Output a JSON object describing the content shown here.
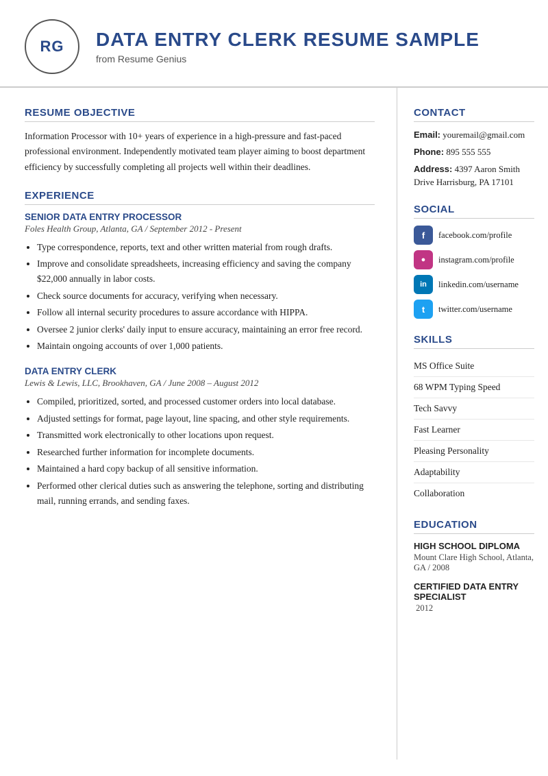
{
  "header": {
    "initials": "RG",
    "title": "DATA ENTRY CLERK RESUME SAMPLE",
    "subtitle": "from Resume Genius"
  },
  "left": {
    "objective_title": "RESUME OBJECTIVE",
    "objective_text": "Information Processor with 10+ years of experience in a high-pressure and fast-paced professional environment. Independently motivated team player aiming to boost department efficiency by successfully completing all projects well within their deadlines.",
    "experience_title": "EXPERIENCE",
    "jobs": [
      {
        "title": "SENIOR DATA ENTRY PROCESSOR",
        "meta": "Foles Health Group, Atlanta, GA  /  September 2012 - Present",
        "bullets": [
          "Type correspondence, reports, text and other written material from rough drafts.",
          "Improve and consolidate spreadsheets, increasing efficiency and saving the company $22,000 annually in labor costs.",
          "Check source documents for accuracy, verifying when necessary.",
          "Follow all internal security procedures to assure accordance with HIPPA.",
          "Oversee 2 junior clerks' daily input to ensure accuracy, maintaining an error free record.",
          "Maintain ongoing accounts of over 1,000 patients."
        ]
      },
      {
        "title": "DATA ENTRY CLERK",
        "meta": "Lewis & Lewis, LLC, Brookhaven, GA  /  June 2008 – August 2012",
        "bullets": [
          "Compiled, prioritized, sorted, and processed customer orders into local database.",
          "Adjusted settings for format, page layout, line spacing, and other style requirements.",
          "Transmitted work electronically to other locations upon request.",
          "Researched further information for incomplete documents.",
          "Maintained a hard copy backup of all sensitive information.",
          "Performed other clerical duties such as answering the telephone, sorting and distributing mail, running errands, and sending faxes."
        ]
      }
    ]
  },
  "right": {
    "contact_title": "CONTACT",
    "email_label": "Email:",
    "email_value": "youremail@gmail.com",
    "phone_label": "Phone:",
    "phone_value": "895 555 555",
    "address_label": "Address:",
    "address_value": "4397 Aaron Smith Drive Harrisburg, PA 17101",
    "social_title": "SOCIAL",
    "socials": [
      {
        "icon": "f",
        "type": "fb",
        "text": "facebook.com/profile"
      },
      {
        "icon": "in",
        "type": "ig",
        "text": "instagram.com/profile"
      },
      {
        "icon": "in",
        "type": "li",
        "text": "linkedin.com/username"
      },
      {
        "icon": "t",
        "type": "tw",
        "text": "twitter.com/username"
      }
    ],
    "skills_title": "SKILLS",
    "skills": [
      "MS Office Suite",
      "68 WPM Typing Speed",
      "Tech Savvy",
      "Fast Learner",
      "Pleasing Personality",
      "Adaptability",
      "Collaboration"
    ],
    "education_title": "EDUCATION",
    "educations": [
      {
        "title": "HIGH SCHOOL DIPLOMA",
        "meta": "Mount Clare High School, Atlanta, GA / 2008"
      },
      {
        "title": "CERTIFIED DATA ENTRY SPECIALIST",
        "meta": "2012"
      }
    ]
  }
}
